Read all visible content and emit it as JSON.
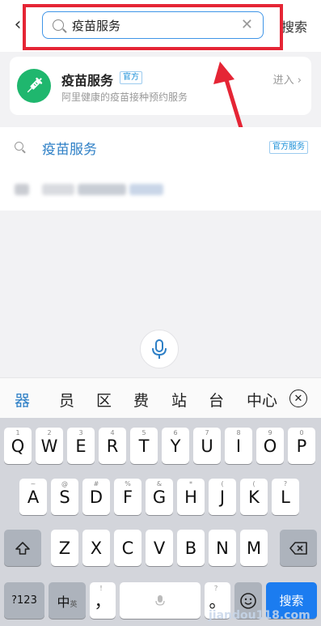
{
  "header": {
    "back_icon": "chevron-left-icon",
    "search_value": "疫苗服务",
    "clear_icon": "close-icon",
    "submit_label": "搜索",
    "highlight_color": "#e52535"
  },
  "result_card": {
    "title": "疫苗服务",
    "tag": "官方",
    "description": "阿里健康的疫苗接种预约服务",
    "enter_label": "进入",
    "icon": "syringe-icon"
  },
  "suggestion": {
    "text": "疫苗服务",
    "badge": "官方服务"
  },
  "candidates": [
    "器",
    "员",
    "区",
    "费",
    "站",
    "台",
    "中心"
  ],
  "keyboard": {
    "row1": [
      {
        "sub": "1",
        "label": "Q"
      },
      {
        "sub": "2",
        "label": "W"
      },
      {
        "sub": "3",
        "label": "E"
      },
      {
        "sub": "4",
        "label": "R"
      },
      {
        "sub": "5",
        "label": "T"
      },
      {
        "sub": "6",
        "label": "Y"
      },
      {
        "sub": "7",
        "label": "U"
      },
      {
        "sub": "8",
        "label": "I"
      },
      {
        "sub": "9",
        "label": "O"
      },
      {
        "sub": "0",
        "label": "P"
      }
    ],
    "row2": [
      {
        "sub": "~",
        "label": "A"
      },
      {
        "sub": "@",
        "label": "S"
      },
      {
        "sub": "#",
        "label": "D"
      },
      {
        "sub": "%",
        "label": "F"
      },
      {
        "sub": "&",
        "label": "G"
      },
      {
        "sub": "*",
        "label": "H"
      },
      {
        "sub": "(",
        "label": "J"
      },
      {
        "sub": "(",
        "label": "K"
      },
      {
        "sub": "?",
        "label": "L"
      }
    ],
    "row3": [
      {
        "sub": "",
        "label": "Z"
      },
      {
        "sub": "",
        "label": "X"
      },
      {
        "sub": "",
        "label": "C"
      },
      {
        "sub": "",
        "label": "V"
      },
      {
        "sub": "",
        "label": "B"
      },
      {
        "sub": "",
        "label": "N"
      },
      {
        "sub": "",
        "label": "M"
      }
    ],
    "num_label": "?123",
    "lang_label": "中",
    "lang_sub": "英",
    "comma_label": "，",
    "comma_sub": "！",
    "period_label": "。",
    "period_sub": "？",
    "submit_label": "搜索",
    "shift_icon": "shift-icon",
    "backspace_icon": "backspace-icon",
    "mic_icon": "microphone-icon",
    "emoji_icon": "emoji-icon"
  },
  "watermark": "jiandou118.com"
}
